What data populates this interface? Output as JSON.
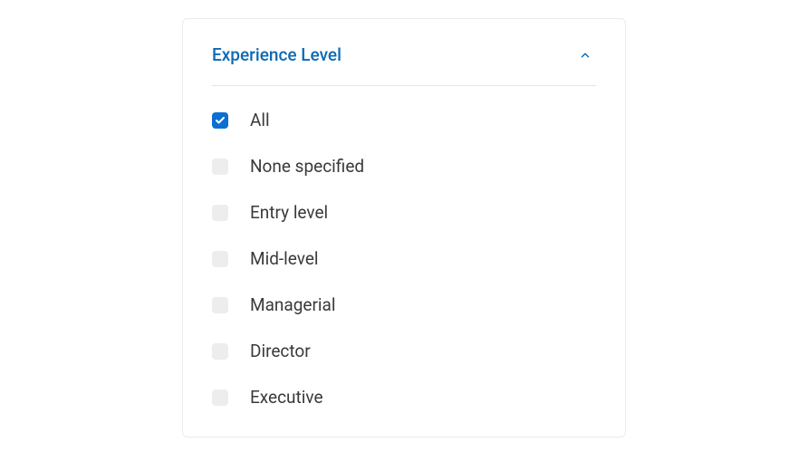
{
  "filter": {
    "title": "Experience Level",
    "expanded": true,
    "options": [
      {
        "label": "All",
        "checked": true
      },
      {
        "label": "None specified",
        "checked": false
      },
      {
        "label": "Entry level",
        "checked": false
      },
      {
        "label": "Mid-level",
        "checked": false
      },
      {
        "label": "Managerial",
        "checked": false
      },
      {
        "label": "Director",
        "checked": false
      },
      {
        "label": "Executive",
        "checked": false
      }
    ]
  }
}
